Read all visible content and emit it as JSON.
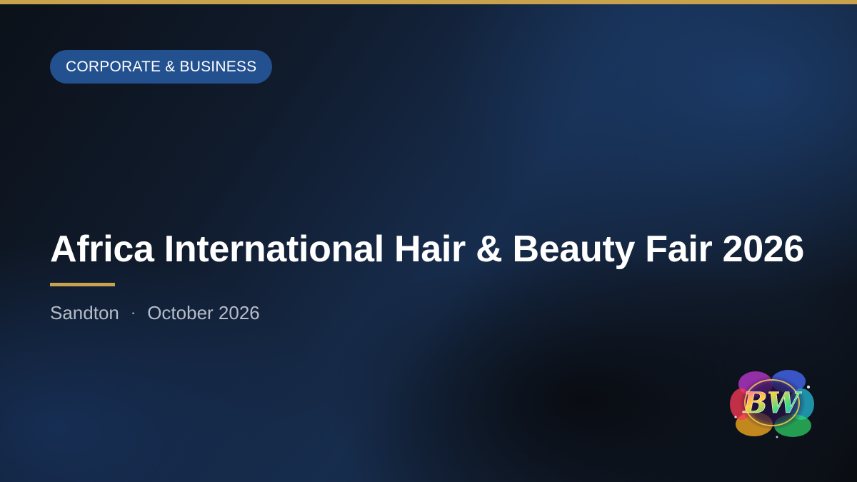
{
  "colors": {
    "accent_gold": "#c9a24e",
    "pill_blue": "#23508f",
    "title_white": "#ffffff",
    "meta_gray": "#b6bdc9"
  },
  "category": {
    "label": "CORPORATE & BUSINESS"
  },
  "event": {
    "title": "Africa International Hair & Beauty Fair 2026",
    "location": "Sandton",
    "separator": "·",
    "date": "October 2026"
  },
  "logo": {
    "icon": "bw-splash-logo-icon",
    "monogram": "BW"
  }
}
